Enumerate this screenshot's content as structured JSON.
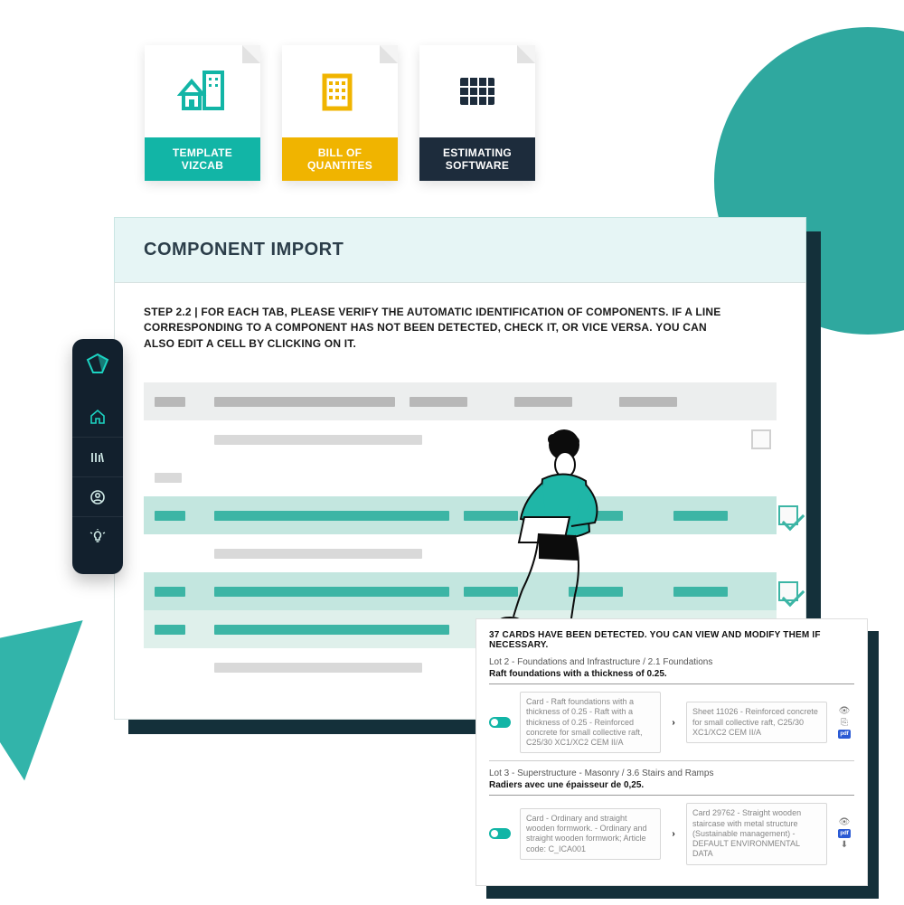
{
  "doccards": {
    "template": "TEMPLATE\nVIZCAB",
    "boq": "BILL OF\nQUANTITES",
    "estimating": "ESTIMATING\nSOFTWARE"
  },
  "window": {
    "title": "COMPONENT IMPORT",
    "step_text": "STEP 2.2 | FOR EACH TAB, PLEASE VERIFY THE AUTOMATIC IDENTIFICATION OF COMPONENTS. IF A LINE CORRESPONDING TO A COMPONENT HAS NOT BEEN DETECTED, CHECK IT, OR VICE VERSA. YOU CAN ALSO EDIT A CELL BY CLICKING ON IT."
  },
  "sidebar": {
    "items": [
      "home",
      "library",
      "account",
      "tips"
    ]
  },
  "detail": {
    "header": "37 CARDS HAVE BEEN DETECTED. YOU CAN VIEW AND MODIFY THEM IF NECESSARY.",
    "lots": [
      {
        "title": "Lot 2 - Foundations and Infrastructure / 2.1 Foundations",
        "subtitle": "Raft foundations with a thickness of 0.25.",
        "card_left": "Card - Raft foundations with a thickness of 0.25 - Raft with a thickness of 0.25 - Reinforced concrete for small collective raft, C25/30 XC1/XC2 CEM II/A",
        "card_right": "Sheet 11026 - Reinforced concrete for small collective raft, C25/30\nXC1/XC2 CEM II/A"
      },
      {
        "title": "Lot 3 - Superstructure - Masonry / 3.6 Stairs and Ramps",
        "subtitle": "Radiers avec une épaisseur de 0,25.",
        "card_left": "Card - Ordinary and straight wooden formwork. - Ordinary and straight wooden formwork; Article code: C_ICA001",
        "card_right": "Card 29762 - Straight wooden staircase with metal structure (Sustainable management) - DEFAULT ENVIRONMENTAL DATA"
      }
    ]
  }
}
